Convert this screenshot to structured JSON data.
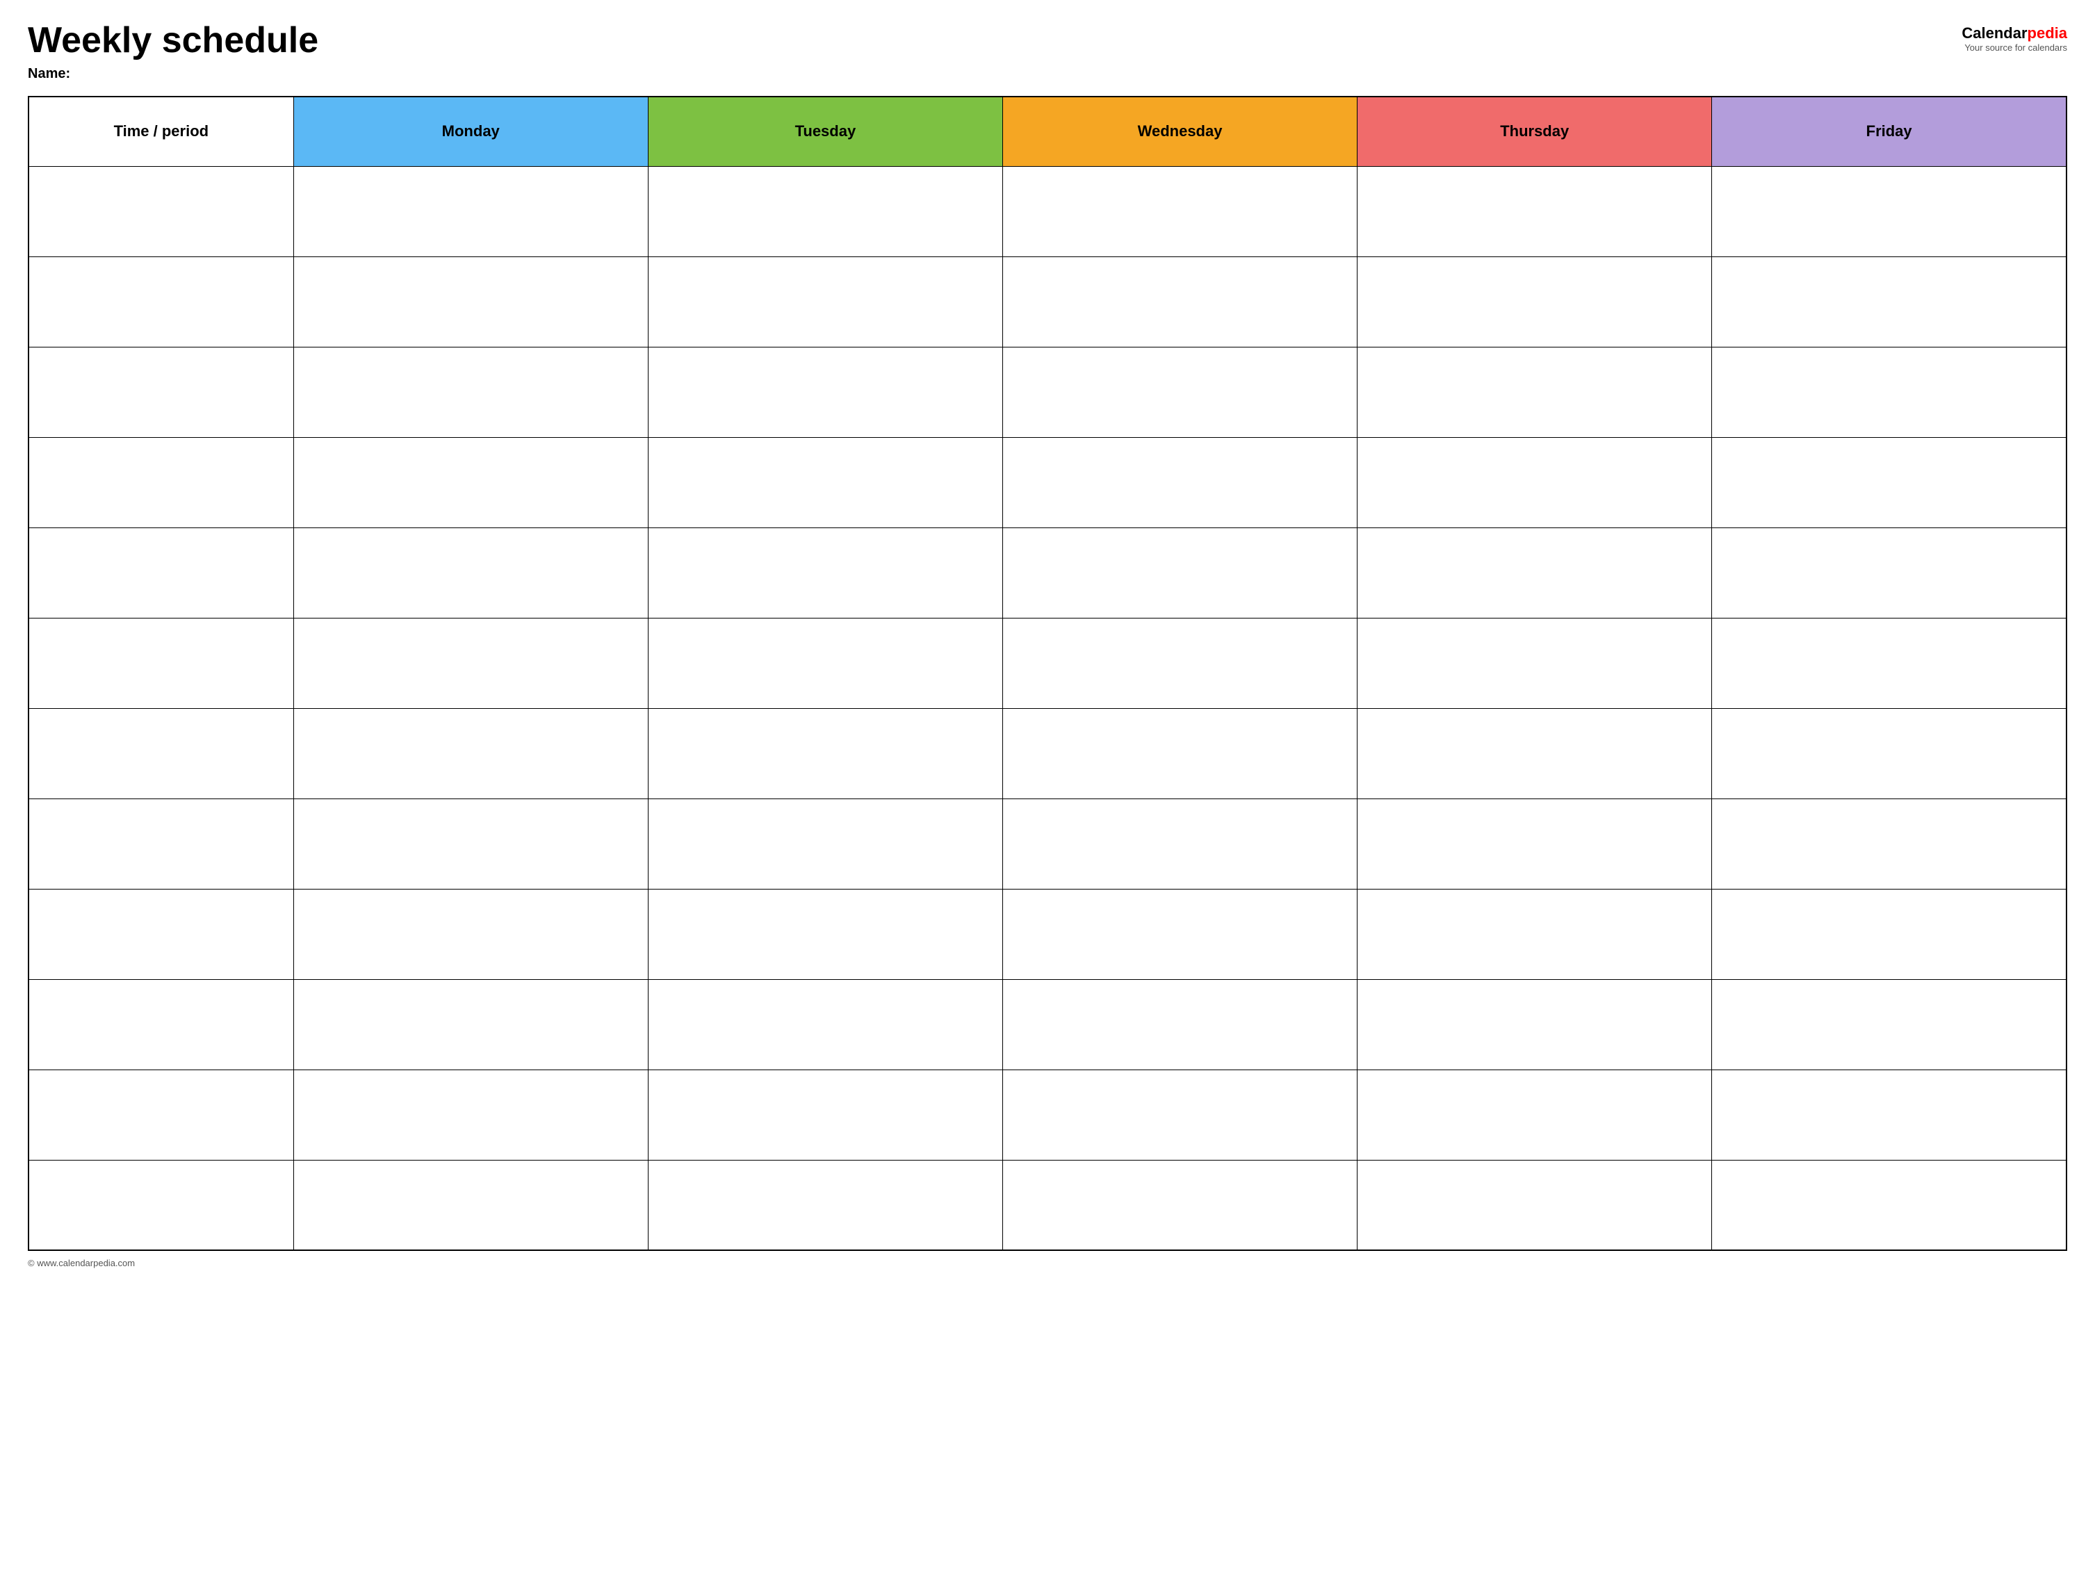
{
  "header": {
    "title": "Weekly schedule",
    "name_label": "Name:",
    "logo": {
      "calendar_text": "Calendar",
      "pedia_text": "pedia",
      "tagline": "Your source for calendars"
    }
  },
  "table": {
    "columns": [
      {
        "label": "Time / period",
        "key": "time",
        "color": "#ffffff"
      },
      {
        "label": "Monday",
        "key": "monday",
        "color": "#5bb8f5"
      },
      {
        "label": "Tuesday",
        "key": "tuesday",
        "color": "#7dc142"
      },
      {
        "label": "Wednesday",
        "key": "wednesday",
        "color": "#f5a623"
      },
      {
        "label": "Thursday",
        "key": "thursday",
        "color": "#f06b6b"
      },
      {
        "label": "Friday",
        "key": "friday",
        "color": "#b39ddb"
      }
    ],
    "rows": 12
  },
  "footer": {
    "url": "© www.calendarpedia.com"
  }
}
